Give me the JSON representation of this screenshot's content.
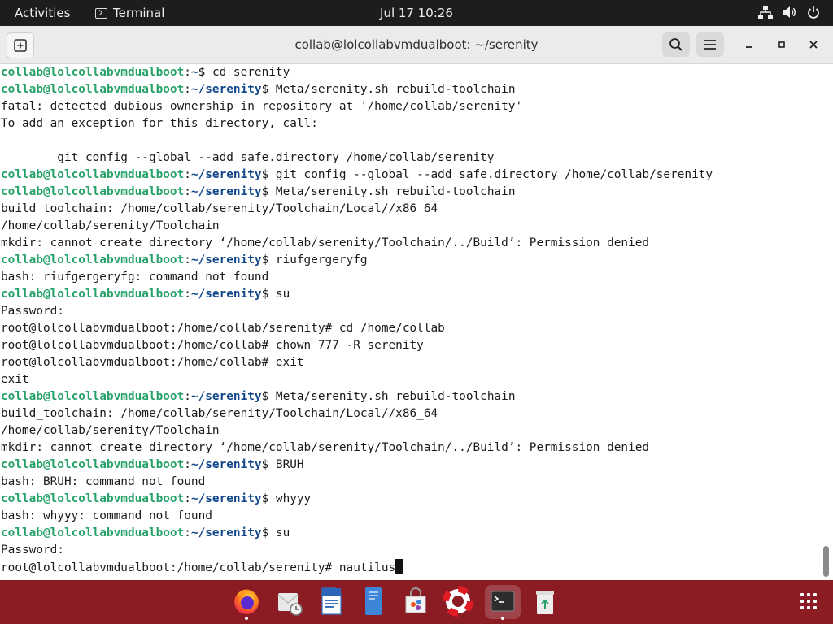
{
  "topbar": {
    "activities": "Activities",
    "app_name": "Terminal",
    "clock": "Jul 17  10:26"
  },
  "window": {
    "title": "collab@lolcollabvmdualboot: ~/serenity"
  },
  "terminal": {
    "lines": [
      {
        "type": "prompt",
        "user": "collab@lolcollabvmdualboot",
        "sep": ":",
        "path": "~",
        "end": "$ ",
        "cmd": "cd serenity"
      },
      {
        "type": "prompt",
        "user": "collab@lolcollabvmdualboot",
        "sep": ":",
        "path": "~/serenity",
        "end": "$ ",
        "cmd": "Meta/serenity.sh rebuild-toolchain"
      },
      {
        "type": "out",
        "text": "fatal: detected dubious ownership in repository at '/home/collab/serenity'"
      },
      {
        "type": "out",
        "text": "To add an exception for this directory, call:"
      },
      {
        "type": "out",
        "text": ""
      },
      {
        "type": "out",
        "text": "        git config --global --add safe.directory /home/collab/serenity"
      },
      {
        "type": "prompt",
        "user": "collab@lolcollabvmdualboot",
        "sep": ":",
        "path": "~/serenity",
        "end": "$ ",
        "cmd": "git config --global --add safe.directory /home/collab/serenity"
      },
      {
        "type": "prompt",
        "user": "collab@lolcollabvmdualboot",
        "sep": ":",
        "path": "~/serenity",
        "end": "$ ",
        "cmd": "Meta/serenity.sh rebuild-toolchain"
      },
      {
        "type": "out",
        "text": "build_toolchain: /home/collab/serenity/Toolchain/Local//x86_64"
      },
      {
        "type": "out",
        "text": "/home/collab/serenity/Toolchain"
      },
      {
        "type": "out",
        "text": "mkdir: cannot create directory ‘/home/collab/serenity/Toolchain/../Build’: Permission denied"
      },
      {
        "type": "prompt",
        "user": "collab@lolcollabvmdualboot",
        "sep": ":",
        "path": "~/serenity",
        "end": "$ ",
        "cmd": "riufgergeryfg"
      },
      {
        "type": "out",
        "text": "bash: riufgergeryfg: command not found"
      },
      {
        "type": "prompt",
        "user": "collab@lolcollabvmdualboot",
        "sep": ":",
        "path": "~/serenity",
        "end": "$ ",
        "cmd": "su"
      },
      {
        "type": "out",
        "text": "Password:"
      },
      {
        "type": "out",
        "text": "root@lolcollabvmdualboot:/home/collab/serenity# cd /home/collab"
      },
      {
        "type": "out",
        "text": "root@lolcollabvmdualboot:/home/collab# chown 777 -R serenity"
      },
      {
        "type": "out",
        "text": "root@lolcollabvmdualboot:/home/collab# exit"
      },
      {
        "type": "out",
        "text": "exit"
      },
      {
        "type": "prompt",
        "user": "collab@lolcollabvmdualboot",
        "sep": ":",
        "path": "~/serenity",
        "end": "$ ",
        "cmd": "Meta/serenity.sh rebuild-toolchain"
      },
      {
        "type": "out",
        "text": "build_toolchain: /home/collab/serenity/Toolchain/Local//x86_64"
      },
      {
        "type": "out",
        "text": "/home/collab/serenity/Toolchain"
      },
      {
        "type": "out",
        "text": "mkdir: cannot create directory ‘/home/collab/serenity/Toolchain/../Build’: Permission denied"
      },
      {
        "type": "prompt",
        "user": "collab@lolcollabvmdualboot",
        "sep": ":",
        "path": "~/serenity",
        "end": "$ ",
        "cmd": "BRUH"
      },
      {
        "type": "out",
        "text": "bash: BRUH: command not found"
      },
      {
        "type": "prompt",
        "user": "collab@lolcollabvmdualboot",
        "sep": ":",
        "path": "~/serenity",
        "end": "$ ",
        "cmd": "whyyy"
      },
      {
        "type": "out",
        "text": "bash: whyyy: command not found"
      },
      {
        "type": "prompt",
        "user": "collab@lolcollabvmdualboot",
        "sep": ":",
        "path": "~/serenity",
        "end": "$ ",
        "cmd": "su"
      },
      {
        "type": "out",
        "text": "Password:"
      },
      {
        "type": "out",
        "text": "root@lolcollabvmdualboot:/home/collab/serenity# nautilus",
        "cursor": true
      }
    ]
  },
  "dock": {
    "items": [
      {
        "name": "firefox-icon",
        "running": true
      },
      {
        "name": "mail-clock-icon",
        "running": false
      },
      {
        "name": "document-editor-icon",
        "running": false
      },
      {
        "name": "document-viewer-icon",
        "running": false
      },
      {
        "name": "software-store-icon",
        "running": false
      },
      {
        "name": "help-lifebuoy-icon",
        "running": false
      },
      {
        "name": "terminal-icon",
        "running": true
      },
      {
        "name": "trash-icon",
        "running": false
      }
    ]
  },
  "colors": {
    "dock_bg": "#8c1c24",
    "prompt_user": "#26a269",
    "prompt_path": "#12488b"
  }
}
